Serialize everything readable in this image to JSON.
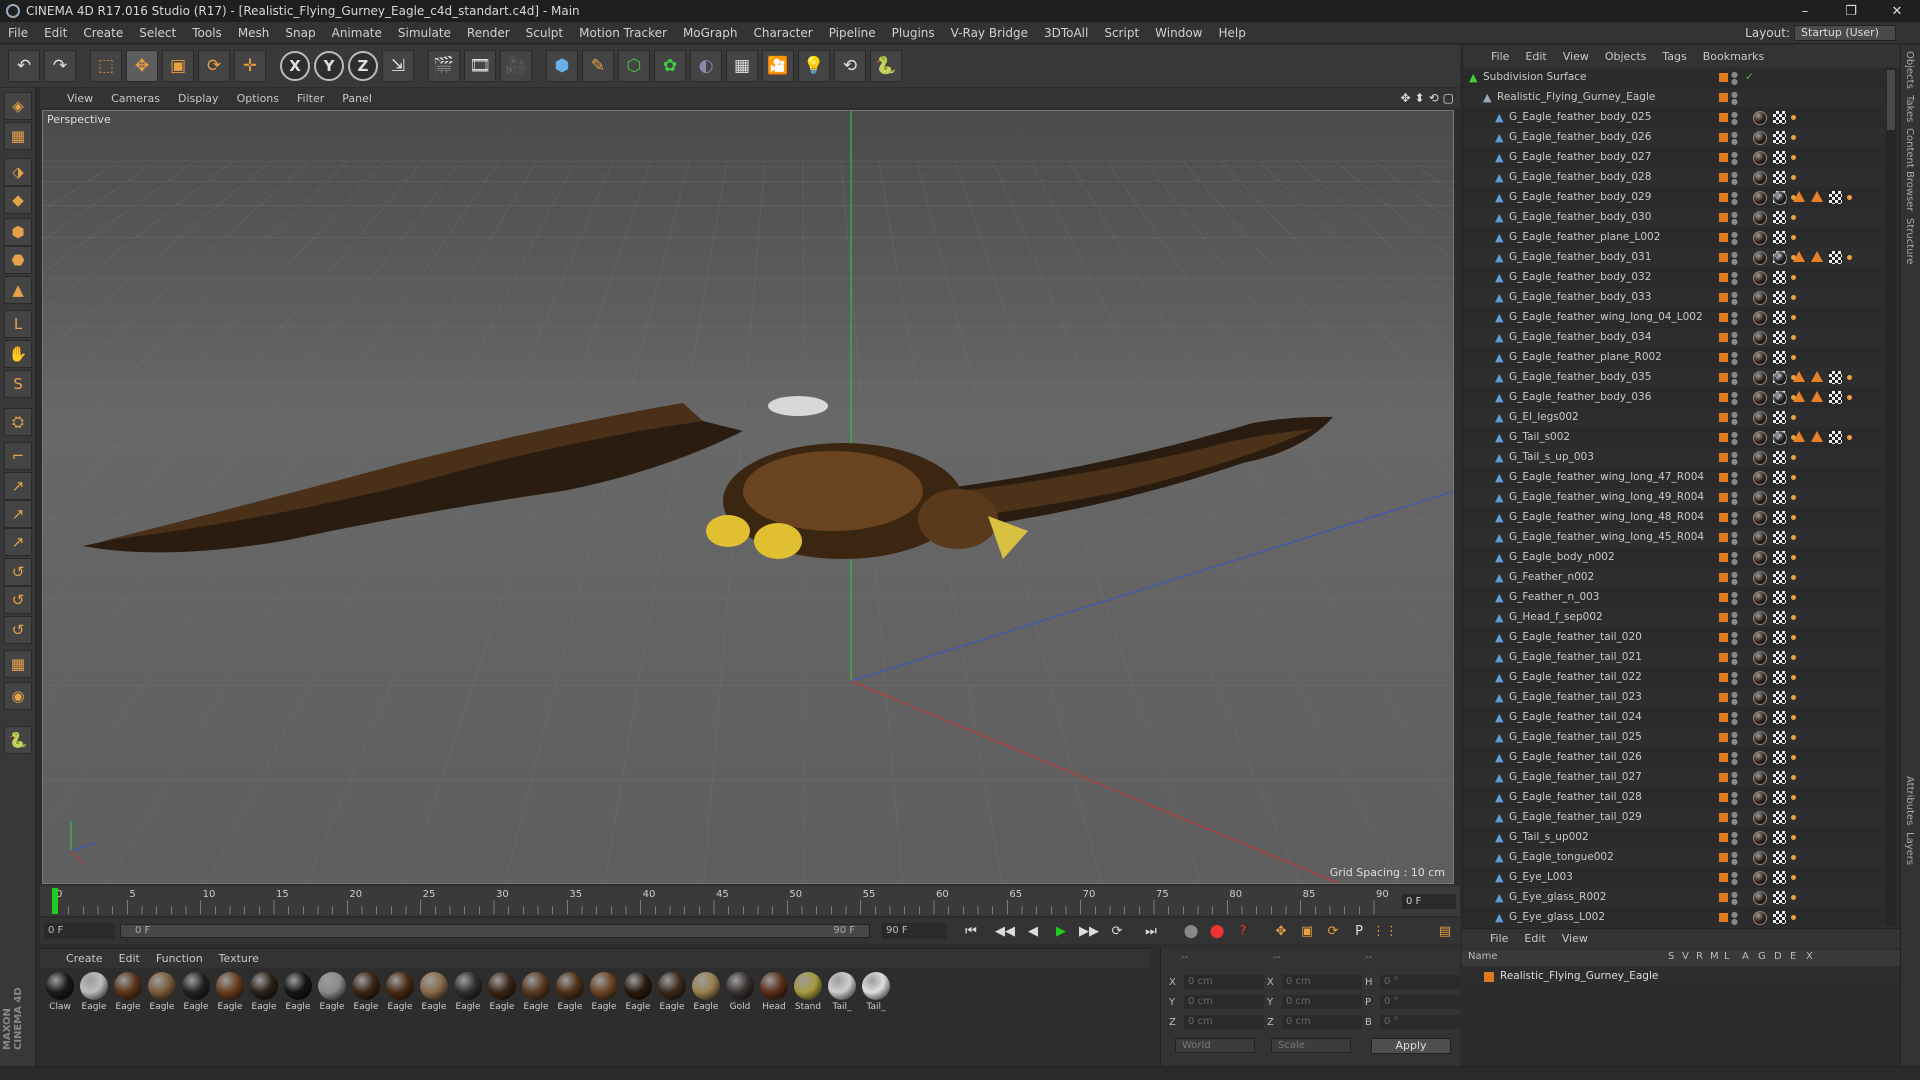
{
  "window": {
    "title": "CINEMA 4D R17.016 Studio (R17) - [Realistic_Flying_Gurney_Eagle_c4d_standart.c4d] - Main",
    "controls": [
      "–",
      "❐",
      "✕"
    ]
  },
  "menu": [
    "File",
    "Edit",
    "Create",
    "Select",
    "Tools",
    "Mesh",
    "Snap",
    "Animate",
    "Simulate",
    "Render",
    "Sculpt",
    "Motion Tracker",
    "MoGraph",
    "Character",
    "Pipeline",
    "Plugins",
    "V-Ray Bridge",
    "3DToAll",
    "Script",
    "Window",
    "Help"
  ],
  "layout": {
    "label": "Layout:",
    "value": "Startup (User)"
  },
  "toolbar": {
    "undo": "↶",
    "redo": "↷",
    "tools": [
      "⬚",
      "✥",
      "▣",
      "⟳",
      "✛"
    ],
    "axes": [
      "X",
      "Y",
      "Z"
    ],
    "coord": "⇲",
    "render": [
      "🎬",
      "🎞",
      "🎥"
    ],
    "create": [
      "⬢",
      "✎",
      "⬡",
      "✿",
      "◐",
      "▦",
      "🎦",
      "💡",
      "⟲",
      "🐍"
    ]
  },
  "lefttools": [
    "◈",
    "▦",
    "⬗",
    "◆",
    "⬢",
    "⬣",
    "▲",
    "L",
    "✋",
    "S",
    "⛭",
    "⌐",
    "↗",
    "↗",
    "↗",
    "↺",
    "↺",
    "↺",
    "▦",
    "◉",
    "🐍"
  ],
  "maxon_label": "MAXON CINEMA 4D",
  "viewport": {
    "menu": [
      "View",
      "Cameras",
      "Display",
      "Options",
      "Filter",
      "Panel"
    ],
    "label": "Perspective",
    "grid_spacing": "Grid Spacing : 10 cm",
    "nav": [
      "✥",
      "⬍",
      "⟲",
      "▢"
    ]
  },
  "timeline": {
    "ticks": [
      "0",
      "5",
      "10",
      "15",
      "20",
      "25",
      "30",
      "35",
      "40",
      "45",
      "50",
      "55",
      "60",
      "65",
      "70",
      "75",
      "80",
      "85",
      "90"
    ],
    "current_frame": "0 F",
    "frame_box": "0 F"
  },
  "transport": {
    "start": "0 F",
    "slider_left": "0 F",
    "slider_right": "90 F",
    "end": "90 F",
    "buttons": [
      "⏮",
      "◀◀",
      "◀",
      "▶",
      "▶▶",
      "⟳",
      "⏭"
    ],
    "rec_buttons": [
      "⬤",
      "⬤",
      "?"
    ],
    "key_buttons": [
      "✥",
      "▣",
      "⟳",
      "P",
      "⋮⋮",
      "▤"
    ]
  },
  "materials": {
    "menu": [
      "Create",
      "Edit",
      "Function",
      "Texture"
    ],
    "items": [
      {
        "name": "Claw",
        "color": "#1a1a1a"
      },
      {
        "name": "Eagle",
        "color": "#bdbdbd"
      },
      {
        "name": "Eagle",
        "color": "#5a3418"
      },
      {
        "name": "Eagle",
        "color": "#7a5a3a"
      },
      {
        "name": "Eagle",
        "color": "#222222"
      },
      {
        "name": "Eagle",
        "color": "#6a3e1e"
      },
      {
        "name": "Eagle",
        "color": "#2a2118"
      },
      {
        "name": "Eagle",
        "color": "#151515"
      },
      {
        "name": "Eagle",
        "color": "#8a8a8a"
      },
      {
        "name": "Eagle",
        "color": "#3a2414"
      },
      {
        "name": "Eagle",
        "color": "#4a2a14"
      },
      {
        "name": "Eagle",
        "color": "#8a6a4a"
      },
      {
        "name": "Eagle",
        "color": "#2e2e2e"
      },
      {
        "name": "Eagle",
        "color": "#3b2616"
      },
      {
        "name": "Eagle",
        "color": "#5a3a20"
      },
      {
        "name": "Eagle",
        "color": "#4e3016"
      },
      {
        "name": "Eagle",
        "color": "#6a4424"
      },
      {
        "name": "Eagle",
        "color": "#2a1a10"
      },
      {
        "name": "Eagle",
        "color": "#3c2a1c"
      },
      {
        "name": "Eagle",
        "color": "#9a8050"
      },
      {
        "name": "Gold",
        "color": "#3a3030"
      },
      {
        "name": "Head",
        "color": "#5a2e18"
      },
      {
        "name": "Stand",
        "color": "#a89a40"
      },
      {
        "name": "Tail_",
        "color": "#cfcfcf"
      },
      {
        "name": "Tail_",
        "color": "#dddddd"
      }
    ]
  },
  "coords": {
    "header": [
      "--",
      "--",
      "--"
    ],
    "rows": [
      {
        "a": "X",
        "av": "0 cm",
        "b": "X",
        "bv": "0 cm",
        "c": "H",
        "cv": "0 °"
      },
      {
        "a": "Y",
        "av": "0 cm",
        "b": "Y",
        "bv": "0 cm",
        "c": "P",
        "cv": "0 °"
      },
      {
        "a": "Z",
        "av": "0 cm",
        "b": "Z",
        "bv": "0 cm",
        "c": "B",
        "cv": "0 °"
      }
    ],
    "world": "World",
    "scale": "Scale",
    "apply": "Apply"
  },
  "objects": {
    "menu": [
      "File",
      "Edit",
      "View",
      "Objects",
      "Tags",
      "Bookmarks"
    ],
    "root": "Subdivision Surface",
    "group": "Realistic_Flying_Gurney_Eagle",
    "items": [
      {
        "name": "G_Eagle_feather_body_025",
        "extra": false
      },
      {
        "name": "G_Eagle_feather_body_026",
        "extra": false
      },
      {
        "name": "G_Eagle_feather_body_027",
        "extra": false
      },
      {
        "name": "G_Eagle_feather_body_028",
        "extra": false
      },
      {
        "name": "G_Eagle_feather_body_029",
        "extra": true
      },
      {
        "name": "G_Eagle_feather_body_030",
        "extra": false
      },
      {
        "name": "G_Eagle_feather_plane_L002",
        "extra": false
      },
      {
        "name": "G_Eagle_feather_body_031",
        "extra": true
      },
      {
        "name": "G_Eagle_feather_body_032",
        "extra": false
      },
      {
        "name": "G_Eagle_feather_body_033",
        "extra": false
      },
      {
        "name": "G_Eagle_feather_wing_long_04_L002",
        "extra": false
      },
      {
        "name": "G_Eagle_feather_body_034",
        "extra": false
      },
      {
        "name": "G_Eagle_feather_plane_R002",
        "extra": false
      },
      {
        "name": "G_Eagle_feather_body_035",
        "extra": true
      },
      {
        "name": "G_Eagle_feather_body_036",
        "extra": true
      },
      {
        "name": "G_El_legs002",
        "extra": false
      },
      {
        "name": "G_Tail_s002",
        "extra": true
      },
      {
        "name": "G_Tail_s_up_003",
        "extra": false
      },
      {
        "name": "G_Eagle_feather_wing_long_47_R004",
        "extra": false
      },
      {
        "name": "G_Eagle_feather_wing_long_49_R004",
        "extra": false
      },
      {
        "name": "G_Eagle_feather_wing_long_48_R004",
        "extra": false
      },
      {
        "name": "G_Eagle_feather_wing_long_45_R004",
        "extra": false
      },
      {
        "name": "G_Eagle_body_n002",
        "extra": false
      },
      {
        "name": "G_Feather_n002",
        "extra": false
      },
      {
        "name": "G_Feather_n_003",
        "extra": false
      },
      {
        "name": "G_Head_f_sep002",
        "extra": false
      },
      {
        "name": "G_Eagle_feather_tail_020",
        "extra": false
      },
      {
        "name": "G_Eagle_feather_tail_021",
        "extra": false
      },
      {
        "name": "G_Eagle_feather_tail_022",
        "extra": false
      },
      {
        "name": "G_Eagle_feather_tail_023",
        "extra": false
      },
      {
        "name": "G_Eagle_feather_tail_024",
        "extra": false
      },
      {
        "name": "G_Eagle_feather_tail_025",
        "extra": false
      },
      {
        "name": "G_Eagle_feather_tail_026",
        "extra": false
      },
      {
        "name": "G_Eagle_feather_tail_027",
        "extra": false
      },
      {
        "name": "G_Eagle_feather_tail_028",
        "extra": false
      },
      {
        "name": "G_Eagle_feather_tail_029",
        "extra": false
      },
      {
        "name": "G_Tail_s_up002",
        "extra": false
      },
      {
        "name": "G_Eagle_tongue002",
        "extra": false
      },
      {
        "name": "G_Eye_L003",
        "extra": false
      },
      {
        "name": "G_Eye_glass_R002",
        "extra": false
      },
      {
        "name": "G_Eye_glass_L002",
        "extra": false
      }
    ]
  },
  "sidetabs": [
    "Objects",
    "Takes",
    "Content Browser",
    "Structure"
  ],
  "sidetabs_bottom": [
    "Attributes",
    "Layers"
  ],
  "layers": {
    "menu": [
      "File",
      "Edit",
      "View"
    ],
    "columns": [
      "Name",
      "S",
      "V",
      "R",
      "M",
      "L",
      "A",
      "G",
      "D",
      "E",
      "X"
    ],
    "row": "Realistic_Flying_Gurney_Eagle",
    "color": "#e07a20"
  },
  "colors": {
    "accent": "#e07a20",
    "axis_x": "#c33",
    "axis_y": "#3c3",
    "axis_z": "#35c"
  }
}
